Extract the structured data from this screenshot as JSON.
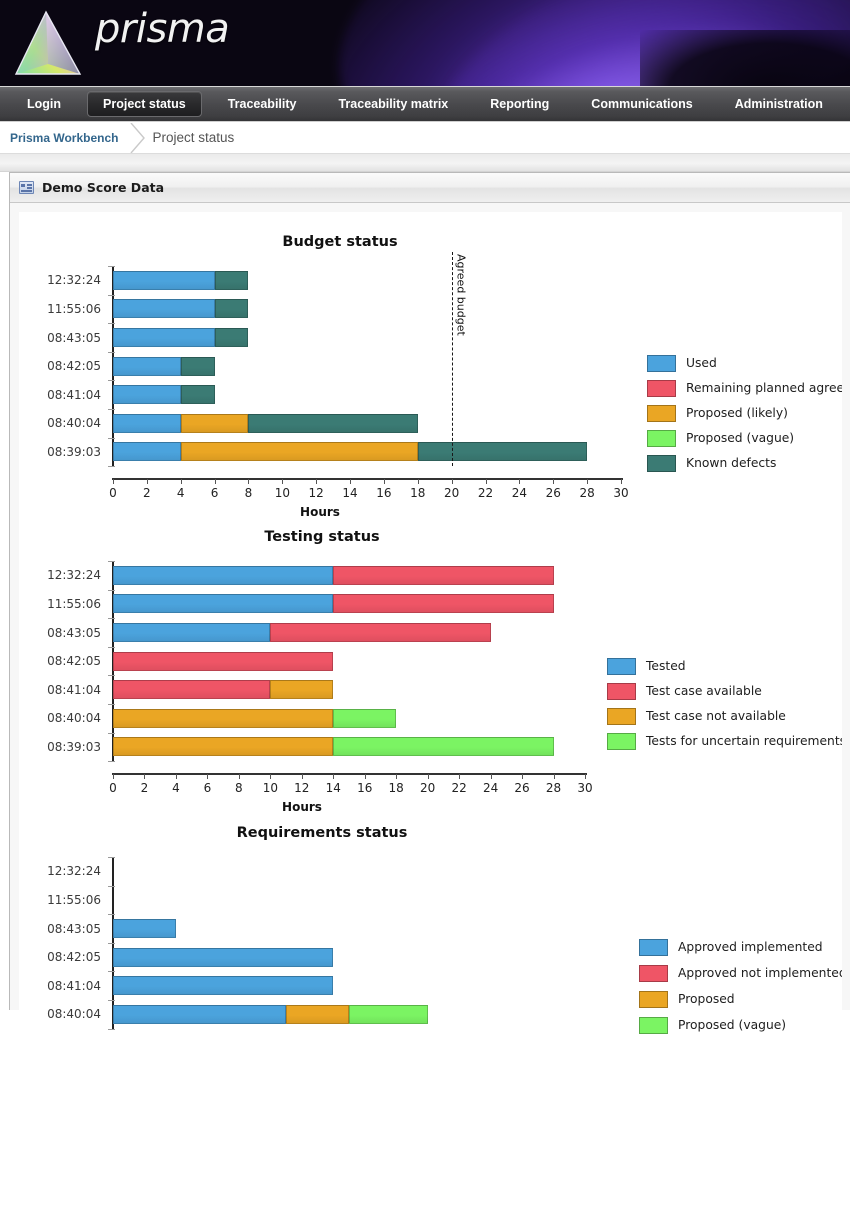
{
  "banner": {
    "brand": "prisma",
    "logo_icon": "prism-triangle-logo"
  },
  "nav": {
    "items": [
      {
        "label": "Login",
        "active": false
      },
      {
        "label": "Project status",
        "active": true
      },
      {
        "label": "Traceability",
        "active": false
      },
      {
        "label": "Traceability matrix",
        "active": false
      },
      {
        "label": "Reporting",
        "active": false
      },
      {
        "label": "Communications",
        "active": false
      },
      {
        "label": "Administration",
        "active": false
      }
    ]
  },
  "breadcrumb": {
    "root": "Prisma Workbench",
    "current": "Project status"
  },
  "panel": {
    "title": "Demo Score Data",
    "icon": "report-panel-icon"
  },
  "colors": {
    "used_blue": "#4ba3dd",
    "remaining_red": "#ef5566",
    "proposed_orange": "#eaa624",
    "vague_green": "#7bf463",
    "defects_teal": "#3b7b74"
  },
  "chart_data": [
    {
      "type": "bar",
      "orientation": "horizontal",
      "stacked": true,
      "title": "Budget status",
      "xlabel": "Hours",
      "ylabel": "",
      "xlim": [
        0,
        30
      ],
      "xticks": [
        0,
        2,
        4,
        6,
        8,
        10,
        12,
        14,
        16,
        18,
        20,
        22,
        24,
        26,
        28,
        30
      ],
      "grid": false,
      "legend_position": "right",
      "categories": [
        "12:32:24",
        "11:55:06",
        "08:43:05",
        "08:42:05",
        "08:41:04",
        "08:40:04",
        "08:39:03"
      ],
      "series": [
        {
          "name": "Used",
          "color": "#4ba3dd",
          "values": [
            6,
            6,
            6,
            4,
            4,
            4,
            4
          ]
        },
        {
          "name": "Remaining planned agreed",
          "color": "#ef5566",
          "values": [
            0,
            0,
            0,
            0,
            0,
            0,
            0
          ]
        },
        {
          "name": "Proposed (likely)",
          "color": "#eaa624",
          "values": [
            0,
            0,
            0,
            0,
            0,
            4,
            14
          ]
        },
        {
          "name": "Proposed (vague)",
          "color": "#7bf463",
          "values": [
            0,
            0,
            0,
            0,
            0,
            0,
            0
          ]
        },
        {
          "name": "Known defects",
          "color": "#3b7b74",
          "values": [
            2,
            2,
            2,
            2,
            2,
            10,
            10
          ]
        }
      ],
      "annotations": [
        {
          "label": "Agreed budget",
          "x": 20,
          "style": "dashed-vertical-line"
        }
      ]
    },
    {
      "type": "bar",
      "orientation": "horizontal",
      "stacked": true,
      "title": "Testing status",
      "xlabel": "Hours",
      "ylabel": "",
      "xlim": [
        0,
        30
      ],
      "xticks": [
        0,
        2,
        4,
        6,
        8,
        10,
        12,
        14,
        16,
        18,
        20,
        22,
        24,
        26,
        28,
        30
      ],
      "grid": false,
      "legend_position": "right",
      "categories": [
        "12:32:24",
        "11:55:06",
        "08:43:05",
        "08:42:05",
        "08:41:04",
        "08:40:04",
        "08:39:03"
      ],
      "series": [
        {
          "name": "Tested",
          "color": "#4ba3dd",
          "values": [
            14,
            14,
            10,
            0,
            0,
            0,
            0
          ]
        },
        {
          "name": "Test case available",
          "color": "#ef5566",
          "values": [
            14,
            14,
            14,
            14,
            10,
            0,
            0
          ]
        },
        {
          "name": "Test case not available",
          "color": "#eaa624",
          "values": [
            0,
            0,
            0,
            0,
            4,
            14,
            14
          ]
        },
        {
          "name": "Tests for uncertain requirements",
          "color": "#7bf463",
          "values": [
            0,
            0,
            0,
            0,
            0,
            4,
            14
          ]
        }
      ],
      "annotations": []
    },
    {
      "type": "bar",
      "orientation": "horizontal",
      "stacked": true,
      "title": "Requirements status",
      "xlabel": "",
      "ylabel": "",
      "xlim": [
        0,
        30
      ],
      "xticks": [],
      "grid": false,
      "legend_position": "right",
      "categories": [
        "12:32:24",
        "11:55:06",
        "08:43:05",
        "08:42:05",
        "08:41:04",
        "08:40:04"
      ],
      "series": [
        {
          "name": "Approved implemented",
          "color": "#4ba3dd",
          "values": [
            0,
            0,
            4,
            14,
            14,
            11
          ]
        },
        {
          "name": "Approved not implemented",
          "color": "#ef5566",
          "values": [
            0,
            0,
            0,
            0,
            0,
            0
          ]
        },
        {
          "name": "Proposed",
          "color": "#eaa624",
          "values": [
            0,
            0,
            0,
            0,
            0,
            4
          ]
        },
        {
          "name": "Proposed (vague)",
          "color": "#7bf463",
          "values": [
            0,
            0,
            0,
            0,
            0,
            5
          ]
        }
      ],
      "annotations": [],
      "legend_visible_entries": [
        "Approved implemented",
        "Approved not implemented",
        "Proposed"
      ],
      "clipped": true
    }
  ]
}
